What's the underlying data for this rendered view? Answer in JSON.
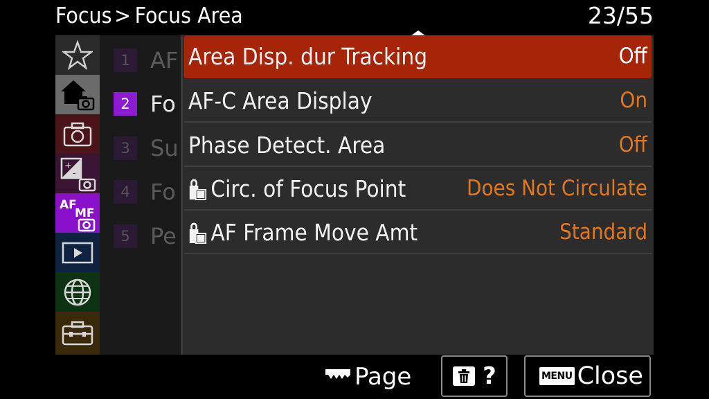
{
  "header": {
    "breadcrumb": [
      "Focus",
      "Focus Area"
    ],
    "separator": ">",
    "page_counter": "23/55"
  },
  "sidebar": {
    "items": [
      {
        "icon": "star-icon",
        "color": "#2b2b2b"
      },
      {
        "icon": "home-camera-icon",
        "color": "#6b6b6b"
      },
      {
        "icon": "camera-icon",
        "color": "#4a1418"
      },
      {
        "icon": "exposure-camera-icon",
        "color": "#3a1433"
      },
      {
        "icon": "af-mf-camera-icon",
        "label_top": "AF",
        "label_bottom": "MF",
        "color": "#8a10cc"
      },
      {
        "icon": "playback-icon",
        "color": "#0f2340"
      },
      {
        "icon": "globe-icon",
        "color": "#0e3312"
      },
      {
        "icon": "toolbox-icon",
        "color": "#3b2a0a"
      }
    ]
  },
  "subsections": [
    {
      "num": "1",
      "label": "AF"
    },
    {
      "num": "2",
      "label": "Fo"
    },
    {
      "num": "3",
      "label": "Su"
    },
    {
      "num": "4",
      "label": "Fo"
    },
    {
      "num": "5",
      "label": "Pe"
    }
  ],
  "settings": [
    {
      "label": "Area Disp. dur Tracking",
      "value": "Off",
      "lock": false
    },
    {
      "label": "AF-C Area Display",
      "value": "On",
      "lock": false
    },
    {
      "label": "Phase Detect. Area",
      "value": "Off",
      "lock": false
    },
    {
      "label": "Circ. of Focus Point",
      "value": "Does Not Circulate",
      "lock": true
    },
    {
      "label": "AF Frame Move Amt",
      "value": "Standard",
      "lock": true
    }
  ],
  "bottom": {
    "page_label": "Page",
    "help_label": "?",
    "menu_badge": "MENU",
    "close_label": "Close"
  },
  "colors": {
    "selected_row": "#a62509",
    "value_orange": "#e0781e",
    "active_subsection": "#8e1ad1"
  }
}
